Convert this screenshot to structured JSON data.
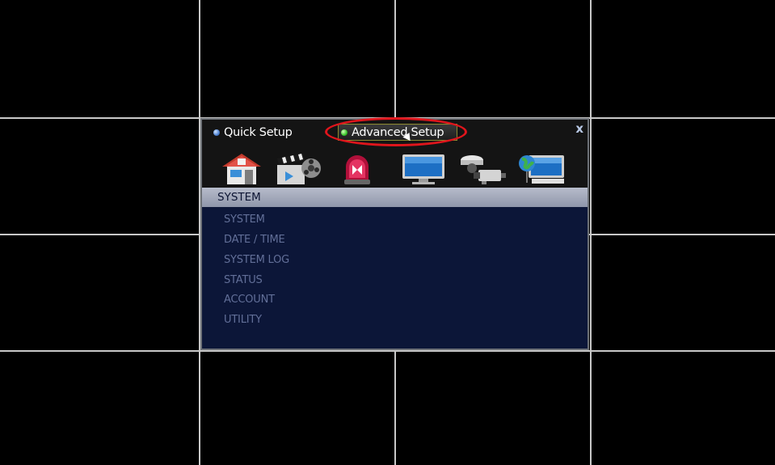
{
  "tabs": {
    "quick": "Quick Setup",
    "advanced": "Advanced Setup"
  },
  "close_glyph": "x",
  "section_title": "SYSTEM",
  "menu": [
    "SYSTEM",
    "DATE / TIME",
    "SYSTEM LOG",
    "STATUS",
    "ACCOUNT",
    "UTILITY"
  ],
  "icons": [
    "system-house-icon",
    "record-clapper-icon",
    "event-alarm-light-icon",
    "display-monitor-icon",
    "camera-icon",
    "network-globe-icon"
  ],
  "colors": {
    "highlight": "#e0151c",
    "menu_bg": "#0c1638",
    "menu_text": "#626f98",
    "header_bg": "#a6acbd"
  }
}
